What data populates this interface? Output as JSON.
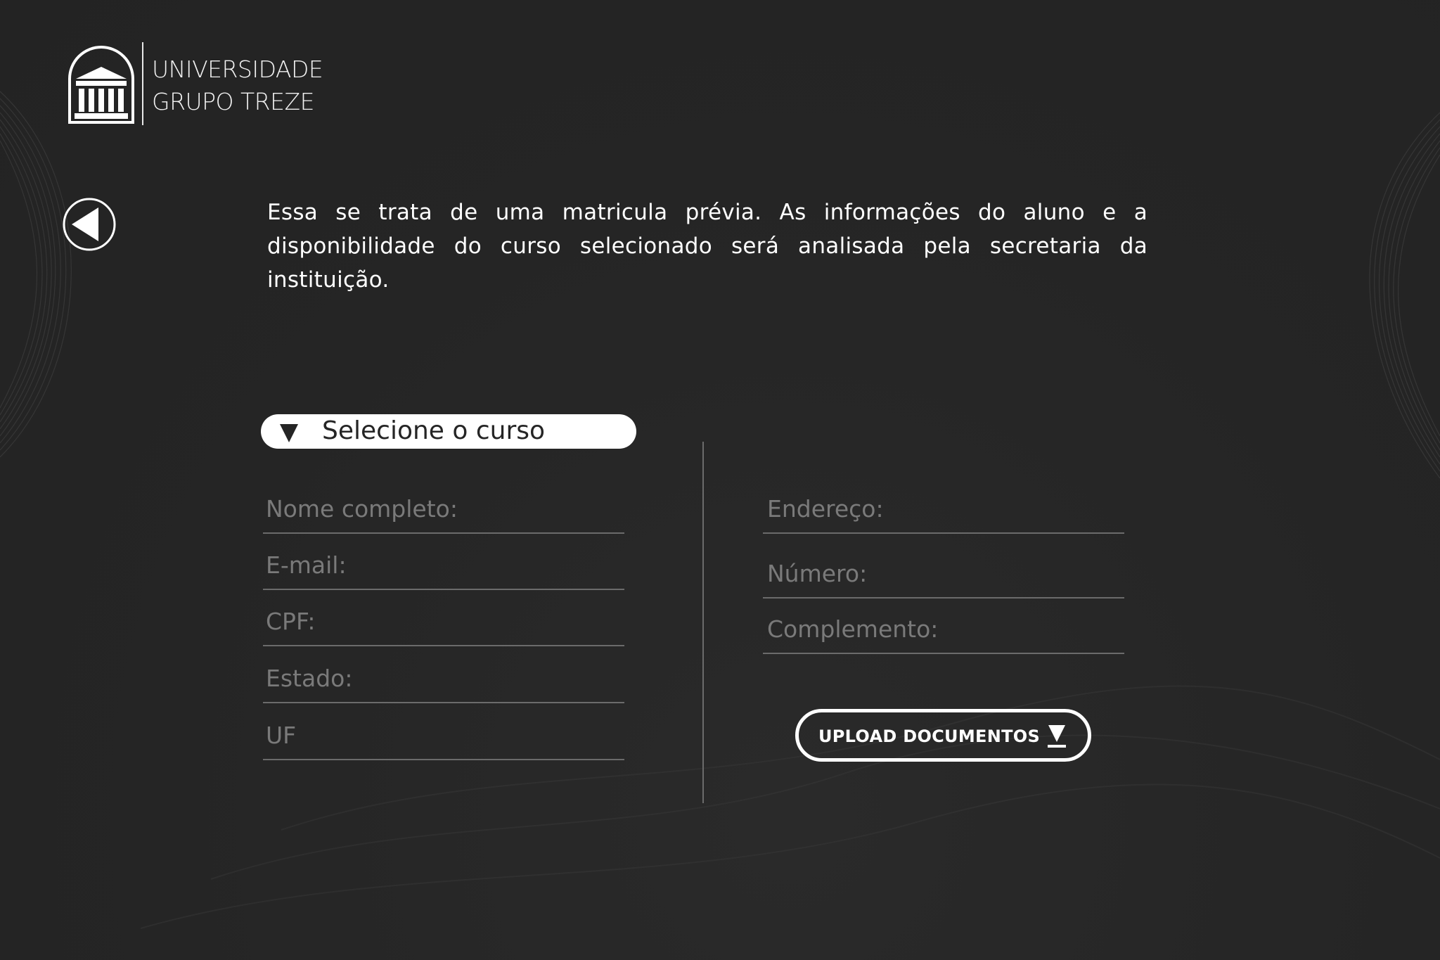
{
  "brand": {
    "line1": "UNIVERSIDADE",
    "line2": "GRUPO TREZE"
  },
  "intro": {
    "text": "Essa se trata de uma matricula prévia. As informações do aluno e  a disponibilidade  do curso selecionado será analisada pela secretaria da instituição."
  },
  "course_select": {
    "label": "Selecione o curso",
    "icon": "triangle-down-icon"
  },
  "form_left": {
    "fields": [
      {
        "label": "Nome completo:"
      },
      {
        "label": "E-mail:"
      },
      {
        "label": "CPF:"
      },
      {
        "label": "Estado:"
      },
      {
        "label": "UF"
      }
    ]
  },
  "form_right": {
    "fields": [
      {
        "label": "Endereço:"
      },
      {
        "label": "Número:"
      },
      {
        "label": "Complemento:"
      }
    ]
  },
  "upload": {
    "label": "UPLOAD DOCUMENTOS",
    "icon": "download-arrow-icon"
  },
  "back": {
    "icon": "back-arrow-icon"
  },
  "colors": {
    "background": "#252525",
    "text": "#ffffff",
    "muted": "#7a7a7a",
    "line": "#6b6b6b"
  }
}
